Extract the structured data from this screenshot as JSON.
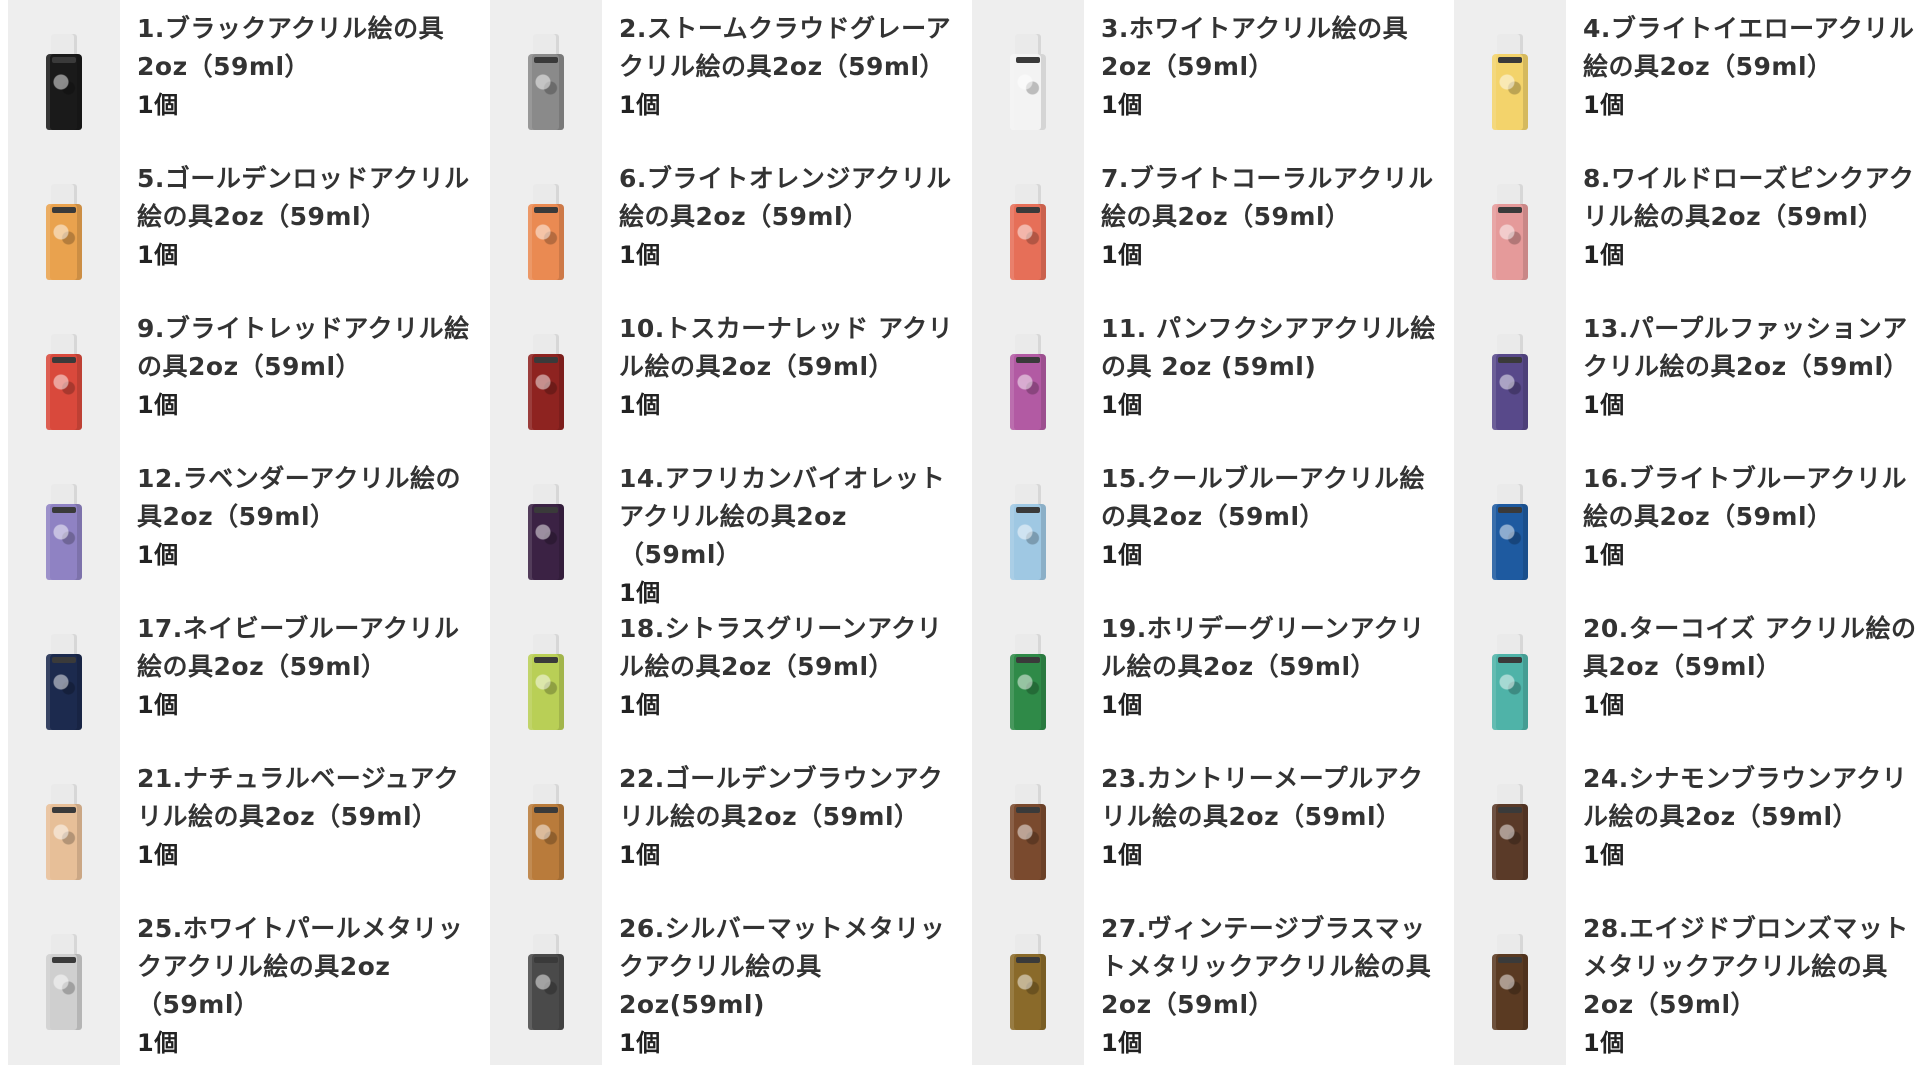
{
  "items": [
    [
      {
        "name": "1.ブラックアクリル絵の具2oz（59ml）",
        "qty": "1個",
        "color": "#1a1a1a"
      },
      {
        "name": "5.ゴールデンロッドアクリル絵の具2oz（59ml）",
        "qty": "1個",
        "color": "#e9a24e"
      },
      {
        "name": "9.ブライトレッドアクリル絵の具2oz（59ml）",
        "qty": "1個",
        "color": "#d9493c"
      },
      {
        "name": "12.ラベンダーアクリル絵の具2oz（59ml）",
        "qty": "1個",
        "color": "#8f82c3"
      },
      {
        "name": "17.ネイビーブルーアクリル絵の具2oz（59ml）",
        "qty": "1個",
        "color": "#1c2a4e"
      },
      {
        "name": "21.ナチュラルベージュアクリル絵の具2oz（59ml）",
        "qty": "1個",
        "color": "#e7bf98"
      },
      {
        "name": "25.ホワイトパールメタリックアクリル絵の具2oz（59ml）",
        "qty": "1個",
        "color": "#cfcfcf"
      }
    ],
    [
      {
        "name": "2.ストームクラウドグレーアクリル絵の具2oz（59ml）",
        "qty": "1個",
        "color": "#8a8a8a"
      },
      {
        "name": "6.ブライトオレンジアクリル絵の具2oz（59ml）",
        "qty": "1個",
        "color": "#ea8a52"
      },
      {
        "name": "10.トスカーナレッド アクリル絵の具2oz（59ml）",
        "qty": "1個",
        "color": "#8e2320"
      },
      {
        "name": "14.アフリカンバイオレットアクリル絵の具2oz（59ml）",
        "qty": "1個",
        "color": "#3b2244"
      },
      {
        "name": "18.シトラスグリーンアクリル絵の具2oz（59ml）",
        "qty": "1個",
        "color": "#b9cf56"
      },
      {
        "name": "22.ゴールデンブラウンアクリル絵の具2oz（59ml）",
        "qty": "1個",
        "color": "#b97b3b"
      },
      {
        "name": "26.シルバーマットメタリックアクリル絵の具2oz(59ml)",
        "qty": "1個",
        "color": "#4a4a4a"
      }
    ],
    [
      {
        "name": "3.ホワイトアクリル絵の具2oz（59ml）",
        "qty": "1個",
        "color": "#f3f3f3"
      },
      {
        "name": "7.ブライトコーラルアクリル絵の具2oz（59ml）",
        "qty": "1個",
        "color": "#e66f58"
      },
      {
        "name": "11. パンフクシアアクリル絵の具 2oz (59ml)",
        "qty": "1個",
        "color": "#b25aa3"
      },
      {
        "name": "15.クールブルーアクリル絵の具2oz（59ml）",
        "qty": "1個",
        "color": "#9fc8e3"
      },
      {
        "name": "19.ホリデーグリーンアクリル絵の具2oz（59ml）",
        "qty": "1個",
        "color": "#2f8a48"
      },
      {
        "name": "23.カントリーメープルアクリル絵の具2oz（59ml）",
        "qty": "1個",
        "color": "#7a4a2e"
      },
      {
        "name": "27.ヴィンテージブラスマットメタリックアクリル絵の具2oz（59ml）",
        "qty": "1個",
        "color": "#8a6a2a"
      }
    ],
    [
      {
        "name": "4.ブライトイエローアクリル絵の具2oz（59ml）",
        "qty": "1個",
        "color": "#f3d36b"
      },
      {
        "name": "8.ワイルドローズピンクアクリル絵の具2oz（59ml）",
        "qty": "1個",
        "color": "#e59a9a"
      },
      {
        "name": "13.パープルファッションアクリル絵の具2oz（59ml）",
        "qty": "1個",
        "color": "#58498a"
      },
      {
        "name": "16.ブライトブルーアクリル絵の具2oz（59ml）",
        "qty": "1個",
        "color": "#1e5aa0"
      },
      {
        "name": "20.ターコイズ アクリル絵の具2oz（59ml）",
        "qty": "1個",
        "color": "#4fb3a8"
      },
      {
        "name": "24.シナモンブラウンアクリル絵の具2oz（59ml）",
        "qty": "1個",
        "color": "#5a3a28"
      },
      {
        "name": "28.エイジドブロンズマットメタリックアクリル絵の具2oz（59ml）",
        "qty": "1個",
        "color": "#5a3a22"
      }
    ]
  ]
}
